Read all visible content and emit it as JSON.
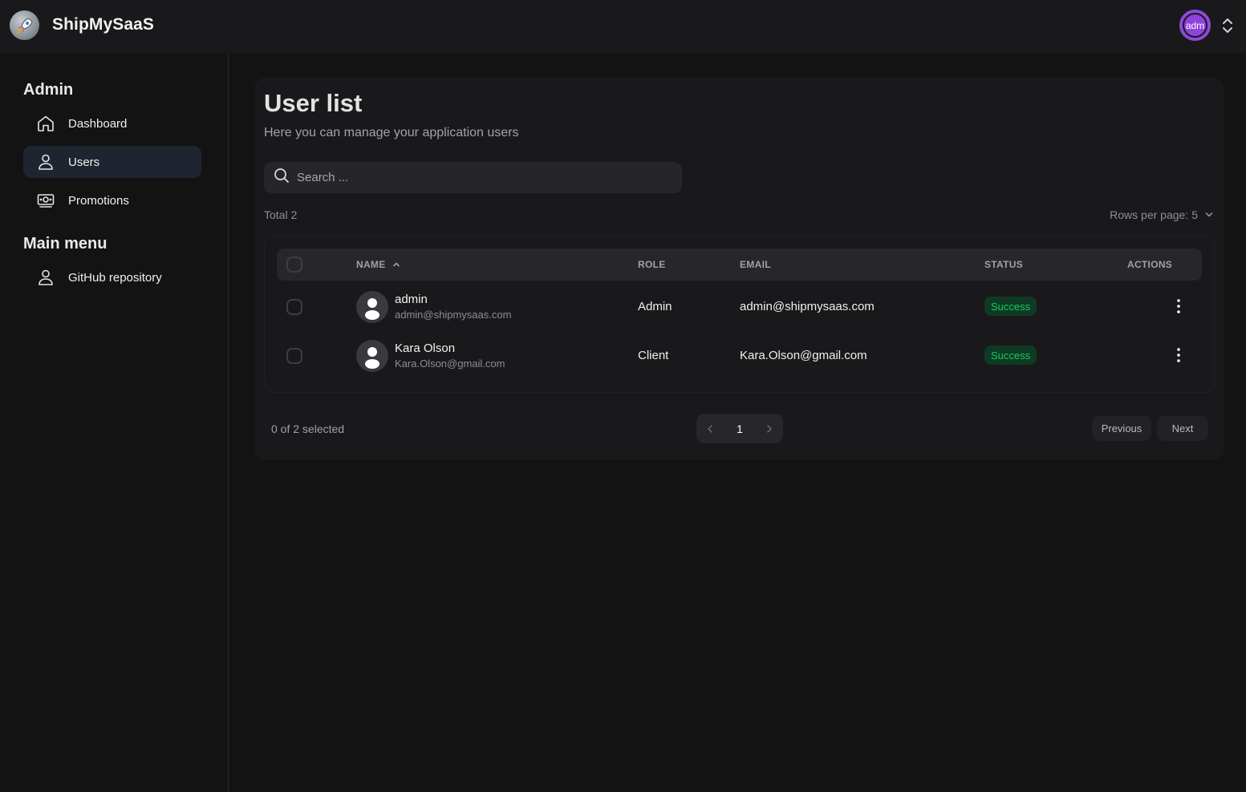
{
  "app": {
    "brand": "ShipMySaaS"
  },
  "header": {
    "avatar_label": "adm"
  },
  "sidebar": {
    "sections": [
      {
        "title": "Admin",
        "items": [
          {
            "label": "Dashboard",
            "icon": "home-icon"
          },
          {
            "label": "Users",
            "icon": "user-icon",
            "active": true
          },
          {
            "label": "Promotions",
            "icon": "banknote-icon"
          }
        ]
      },
      {
        "title": "Main menu",
        "items": [
          {
            "label": "GitHub repository",
            "icon": "user-icon"
          }
        ]
      }
    ]
  },
  "main": {
    "title": "User list",
    "subtitle": "Here you can manage your application users",
    "search": {
      "placeholder": "Search ...",
      "value": ""
    },
    "total": "Total 2",
    "rows_per_page": {
      "label": "Rows per page:",
      "value": "5"
    },
    "table": {
      "columns": [
        "NAME",
        "ROLE",
        "EMAIL",
        "STATUS",
        "ACTIONS"
      ],
      "rows": [
        {
          "name": "admin",
          "subtitle": "admin@shipmysaas.com",
          "role": "Admin",
          "email": "admin@shipmysaas.com",
          "status": "Success"
        },
        {
          "name": "Kara Olson",
          "subtitle": "Kara.Olson@gmail.com",
          "role": "Client",
          "email": "Kara.Olson@gmail.com",
          "status": "Success"
        }
      ]
    },
    "footer": {
      "selected": "0 of 2 selected",
      "current_page": "1",
      "previous_label": "Previous",
      "next_label": "Next"
    }
  },
  "colors": {
    "accent_purple": "#8e44dc",
    "success_text": "#17c964",
    "success_bg": "#0f3a23"
  }
}
